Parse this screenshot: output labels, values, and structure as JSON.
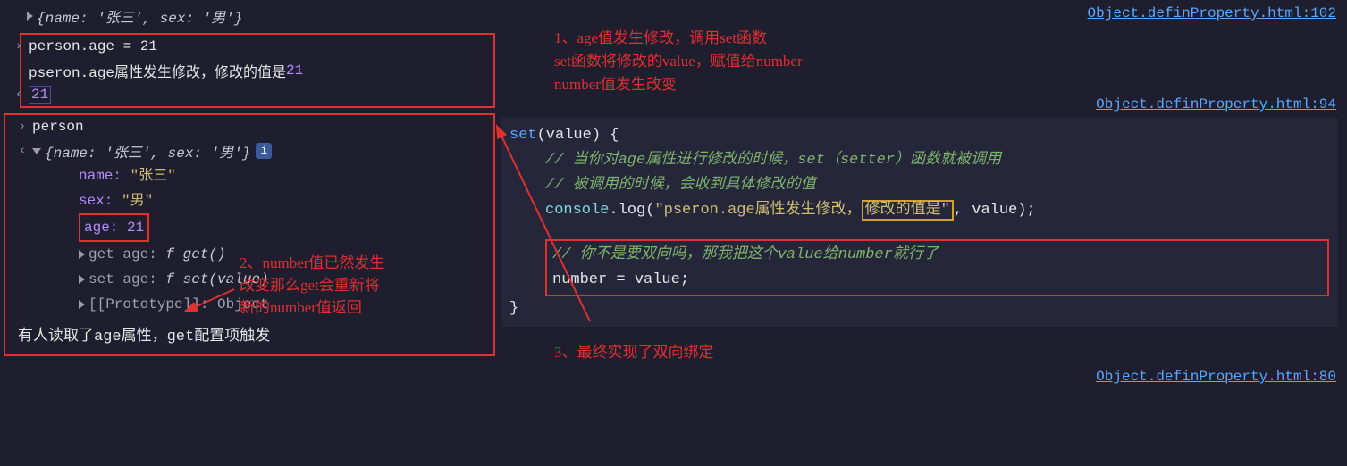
{
  "console": {
    "line1": "{name: '张三', sex: '男'}",
    "input1": "person.age = 21",
    "log1_text": "pseron.age属性发生修改，修改的值是 ",
    "log1_val": "21",
    "return1": "21",
    "input2": "person",
    "obj_summary": "{name: '张三', sex: '男'}",
    "props": {
      "name_k": "name:",
      "name_v": "\"张三\"",
      "sex_k": "sex:",
      "sex_v": "\"男\"",
      "age_k": "age:",
      "age_v": "21",
      "getter": "get age: ",
      "getter_f": "f get()",
      "setter": "set age: ",
      "setter_f": "f set(value)",
      "proto": "[[Prototype]]: Object"
    },
    "bottom_log": "有人读取了age属性，get配置项触发"
  },
  "links": {
    "l1": "Object.definProperty.html:102",
    "l2": "Object.definProperty.html:94",
    "l3": "Object.definProperty.html:80"
  },
  "annotations": {
    "a1_l1": "1、age值发生修改，调用set函数",
    "a1_l2": "set函数将修改的value，赋值给number",
    "a1_l3": "number值发生改变",
    "a2_l1": "2、number值已然发生",
    "a2_l2": "改变那么get会重新将",
    "a2_l3": "新的number值返回",
    "a3": "3、最终实现了双向绑定"
  },
  "code": {
    "sig_set": "set",
    "sig_val": "(value) ",
    "brace_o": "{",
    "c1": "// 当你对age属性进行修改的时候，set（setter）函数就被调用",
    "c2": "// 被调用的时候，会收到具体修改的值",
    "log_a": "console",
    "log_b": ".log(",
    "log_s1": "\"pseron.age属性发生修改，",
    "log_s2": "修改的值是\"",
    "log_c": ", value);",
    "c3": "// 你不是要双向吗，那我把这个value给number就行了",
    "assign": "number = value;",
    "brace_c": "}"
  }
}
